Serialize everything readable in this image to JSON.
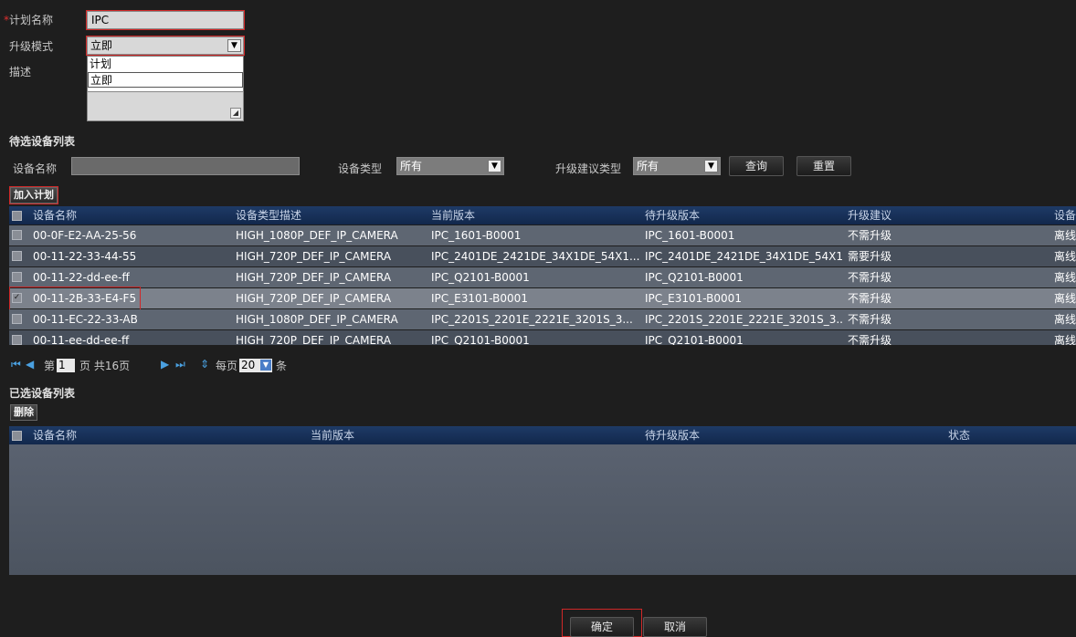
{
  "form": {
    "plan_name_label": "计划名称",
    "plan_name_required": "*",
    "plan_name_value": "IPC",
    "upgrade_mode_label": "升级模式",
    "upgrade_mode_value": "立即",
    "upgrade_mode_options": [
      "计划",
      "立即"
    ],
    "description_label": "描述"
  },
  "candidate": {
    "title": "待选设备列表",
    "device_name_label": "设备名称",
    "device_type_label": "设备类型",
    "device_type_value": "所有",
    "suggest_type_label": "升级建议类型",
    "suggest_type_value": "所有",
    "query_btn": "查询",
    "reset_btn": "重置",
    "add_btn": "加入计划",
    "columns": [
      "设备名称",
      "设备类型描述",
      "当前版本",
      "待升级版本",
      "升级建议",
      "设备"
    ],
    "rows": [
      {
        "name": "00-0F-E2-AA-25-56",
        "type": "HIGH_1080P_DEF_IP_CAMERA",
        "cur": "IPC_1601-B0001",
        "target": "IPC_1601-B0001",
        "advice": "不需升级",
        "status": "离线",
        "checked": false
      },
      {
        "name": "00-11-22-33-44-55",
        "type": "HIGH_720P_DEF_IP_CAMERA",
        "cur": "IPC_2401DE_2421DE_34X1DE_54X1...",
        "target": "IPC_2401DE_2421DE_34X1DE_54X1...",
        "advice": "需要升级",
        "status": "离线",
        "checked": false
      },
      {
        "name": "00-11-22-dd-ee-ff",
        "type": "HIGH_720P_DEF_IP_CAMERA",
        "cur": "IPC_Q2101-B0001",
        "target": "IPC_Q2101-B0001",
        "advice": "不需升级",
        "status": "离线",
        "checked": false
      },
      {
        "name": "00-11-2B-33-E4-F5",
        "type": "HIGH_720P_DEF_IP_CAMERA",
        "cur": "IPC_E3101-B0001",
        "target": "IPC_E3101-B0001",
        "advice": "不需升级",
        "status": "离线",
        "checked": true
      },
      {
        "name": "00-11-EC-22-33-AB",
        "type": "HIGH_1080P_DEF_IP_CAMERA",
        "cur": "IPC_2201S_2201E_2221E_3201S_3...",
        "target": "IPC_2201S_2201E_2221E_3201S_3...",
        "advice": "不需升级",
        "status": "离线",
        "checked": false
      },
      {
        "name": "00-11-ee-dd-ee-ff",
        "type": "HIGH_720P_DEF_IP_CAMERA",
        "cur": "IPC_Q2101-B0001",
        "target": "IPC_Q2101-B0001",
        "advice": "不需升级",
        "status": "离线",
        "checked": false
      }
    ],
    "pager": {
      "page_prefix": "第",
      "page_value": "1",
      "page_suffix": "页 共16页",
      "per_page_label": "每页",
      "per_page_value": "20",
      "per_page_unit": "条"
    }
  },
  "selected": {
    "title": "已选设备列表",
    "delete_btn": "删除",
    "columns": [
      "设备名称",
      "当前版本",
      "待升级版本",
      "状态"
    ]
  },
  "footer": {
    "ok_btn": "确定",
    "cancel_btn": "取消"
  },
  "colors": {
    "background": "#1e1e1e",
    "header_blue": "#1e3a66",
    "row_gray": "#5e6672",
    "highlight_red": "#d02828"
  }
}
